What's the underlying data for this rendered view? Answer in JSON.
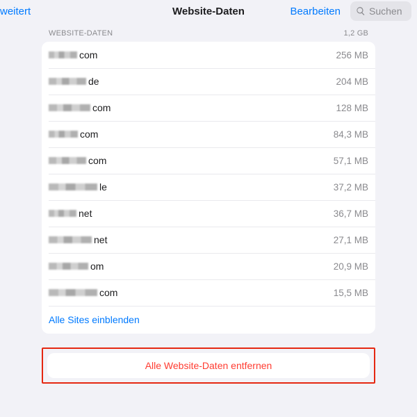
{
  "nav": {
    "back": "weitert",
    "title": "Website-Daten",
    "edit": "Bearbeiten",
    "search_placeholder": "Suchen"
  },
  "section": {
    "heading": "WEBSITE-DATEN",
    "total": "1,2 GB"
  },
  "sites": [
    {
      "obfuscated_width": 41,
      "suffix": "com",
      "size": "256 MB"
    },
    {
      "obfuscated_width": 54,
      "suffix": "de",
      "size": "204 MB"
    },
    {
      "obfuscated_width": 60,
      "suffix": "com",
      "size": "128 MB"
    },
    {
      "obfuscated_width": 42,
      "suffix": "com",
      "size": "84,3 MB"
    },
    {
      "obfuscated_width": 54,
      "suffix": "com",
      "size": "57,1 MB"
    },
    {
      "obfuscated_width": 70,
      "suffix": "le",
      "size": "37,2 MB"
    },
    {
      "obfuscated_width": 40,
      "suffix": "net",
      "size": "36,7 MB"
    },
    {
      "obfuscated_width": 62,
      "suffix": "net",
      "size": "27,1 MB"
    },
    {
      "obfuscated_width": 57,
      "suffix": "om",
      "size": "20,9 MB"
    },
    {
      "obfuscated_width": 70,
      "suffix": "com",
      "size": "15,5 MB"
    }
  ],
  "show_all": "Alle Sites einblenden",
  "remove_all": "Alle Website-Daten entfernen"
}
